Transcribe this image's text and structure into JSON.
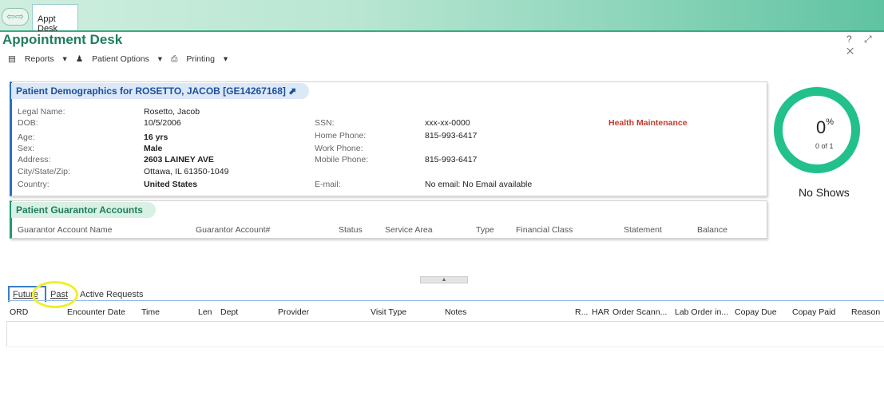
{
  "tab": {
    "label": "Appt Desk"
  },
  "nav_glyph": "⇦⇨",
  "title": "Appointment Desk",
  "window_icons": "? ⤢ ✕",
  "toolbar": {
    "reports": "Reports",
    "patient_options": "Patient Options",
    "printing": "Printing"
  },
  "demographics": {
    "header": "Patient Demographics for ROSETTO, JACOB [GE14267168]",
    "legal_name_label": "Legal Name:",
    "legal_name": "Rosetto, Jacob",
    "dob_label": "DOB:",
    "dob": "10/5/2006",
    "age_label": "Age:",
    "age": "16 yrs",
    "sex_label": "Sex:",
    "sex": "Male",
    "address_label": "Address:",
    "address": "2603 LAINEY AVE",
    "csz_label": "City/State/Zip:",
    "csz": "Ottawa, IL 61350-1049",
    "country_label": "Country:",
    "country": "United States",
    "ssn_label": "SSN:",
    "ssn": "xxx-xx-0000",
    "home_phone_label": "Home Phone:",
    "home_phone": "815-993-6417",
    "work_phone_label": "Work Phone:",
    "mobile_phone_label": "Mobile Phone:",
    "mobile_phone": "815-993-6417",
    "email_label": "E-mail:",
    "email": "No email: No Email available",
    "health_maintenance": "Health Maintenance"
  },
  "guarantor": {
    "header": "Patient Guarantor Accounts",
    "columns": [
      "Guarantor Account Name",
      "Guarantor Account#",
      "Status",
      "Service Area",
      "Type",
      "Financial Class",
      "Statement",
      "Balance"
    ]
  },
  "no_shows": {
    "percent": "0",
    "percent_sign": "%",
    "fraction": "0 of 1",
    "label": "No Shows",
    "accent": "#22c08c"
  },
  "appt_tabs": [
    "Future",
    "Past",
    "Active Requests"
  ],
  "table": {
    "columns": [
      "ORD",
      "Encounter Date",
      "Time",
      "Len",
      "Dept",
      "Provider",
      "Visit Type",
      "Notes",
      "R...",
      "HAR",
      "Order Scann...",
      "Lab Order in...",
      "Copay Due",
      "Copay Paid",
      "Reason"
    ]
  },
  "splitter_glyph": "▲"
}
